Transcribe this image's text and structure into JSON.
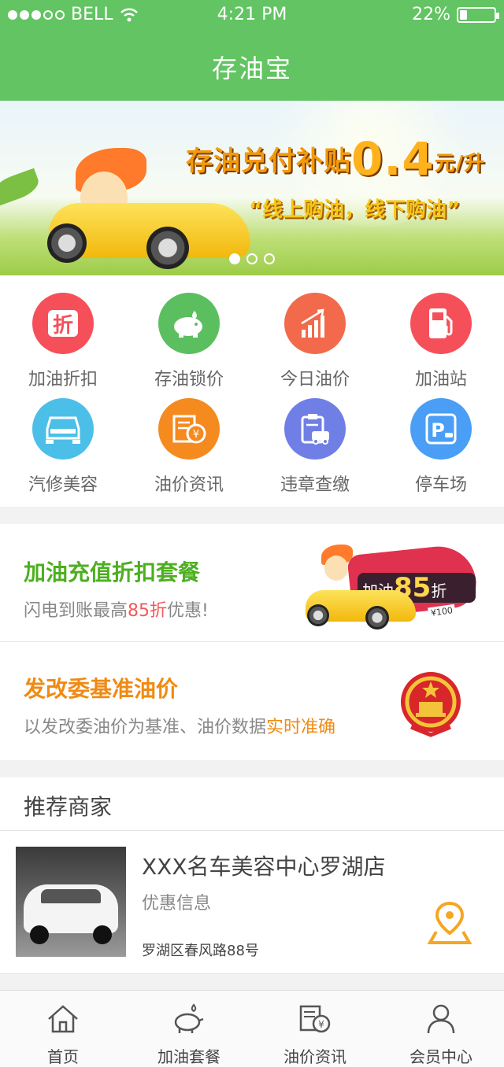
{
  "status_bar": {
    "carrier": "BELL",
    "time": "4:21 PM",
    "battery": "22%",
    "battery_level": 0.22
  },
  "header": {
    "title": "存油宝"
  },
  "banner": {
    "headline": "存油兑付补贴",
    "amount": "0.4",
    "unit": "元/升",
    "slogan": "“线上购油，线下购油”",
    "pages": 3,
    "active_page": 1
  },
  "menu": [
    {
      "label": "加油折扣",
      "icon": "discount-icon",
      "color": "#f5505a"
    },
    {
      "label": "存油锁价",
      "icon": "piggy-bank-icon",
      "color": "#5bbf60"
    },
    {
      "label": "今日油价",
      "icon": "price-trend-icon",
      "color": "#f26a4b"
    },
    {
      "label": "加油站",
      "icon": "fuel-pump-icon",
      "color": "#f5505a"
    },
    {
      "label": "汽修美容",
      "icon": "car-wash-icon",
      "color": "#4cbfe8"
    },
    {
      "label": "油价资讯",
      "icon": "news-coin-icon",
      "color": "#f58a1f"
    },
    {
      "label": "违章查缴",
      "icon": "clipboard-car-icon",
      "color": "#6f7fe6"
    },
    {
      "label": "停车场",
      "icon": "parking-icon",
      "color": "#4a9ef5"
    }
  ],
  "promo_recharge": {
    "title": "加油充值折扣套餐",
    "subtitle_pre": "闪电到账最高",
    "subtitle_highlight": "85折",
    "subtitle_post": "优惠!",
    "badge_text": "加油",
    "badge_number": "85",
    "badge_suffix": "折",
    "coupon": "¥100",
    "title_color": "#4caf1f",
    "highlight_color": "#f05a5a"
  },
  "promo_price": {
    "title": "发改委基准油价",
    "subtitle_pre": "以发改委油价为基准、油价数据",
    "subtitle_highlight": "实时准确",
    "title_color": "#f08a13",
    "highlight_color": "#f08a13"
  },
  "recommend": {
    "section_title": "推荐商家",
    "shops": [
      {
        "name": "XXX名车美容中心罗湖店",
        "promo": "优惠信息",
        "address": "罗湖区春风路88号"
      }
    ]
  },
  "tabbar": [
    {
      "label": "首页",
      "icon": "home-icon"
    },
    {
      "label": "加油套餐",
      "icon": "piggy-bank-icon"
    },
    {
      "label": "油价资讯",
      "icon": "news-coin-icon"
    },
    {
      "label": "会员中心",
      "icon": "user-icon"
    }
  ]
}
